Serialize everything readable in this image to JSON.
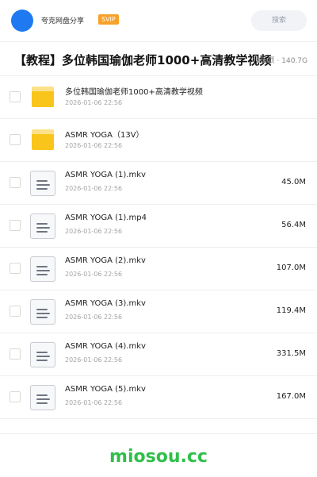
{
  "header": {
    "app_name": "夸克网盘分享",
    "badge": "SVIP",
    "search_placeholder": "搜索"
  },
  "title_bar": {
    "title": "【教程】多位韩国瑜伽老师1000+高清教学视频",
    "meta": "93 项 · 140.7G"
  },
  "files": [
    {
      "name": "多位韩国瑜伽老师1000+高清教学视频",
      "date": "2026-01-06 22:56",
      "size": "",
      "type": "folder",
      "icon": "folder-icon"
    },
    {
      "name": "ASMR YOGA（13V）",
      "date": "2026-01-06 22:56",
      "size": "",
      "type": "folder",
      "icon": "folder-icon"
    },
    {
      "name": "ASMR YOGA (1).mkv",
      "date": "2026-01-06 22:56",
      "size": "45.0M",
      "type": "file",
      "icon": "file-icon"
    },
    {
      "name": "ASMR YOGA (1).mp4",
      "date": "2026-01-06 22:56",
      "size": "56.4M",
      "type": "file",
      "icon": "file-icon"
    },
    {
      "name": "ASMR YOGA (2).mkv",
      "date": "2026-01-06 22:56",
      "size": "107.0M",
      "type": "file",
      "icon": "file-icon"
    },
    {
      "name": "ASMR YOGA (3).mkv",
      "date": "2026-01-06 22:56",
      "size": "119.4M",
      "type": "file",
      "icon": "file-icon"
    },
    {
      "name": "ASMR YOGA (4).mkv",
      "date": "2026-01-06 22:56",
      "size": "331.5M",
      "type": "file",
      "icon": "file-icon"
    },
    {
      "name": "ASMR YOGA (5).mkv",
      "date": "2026-01-06 22:56",
      "size": "167.0M",
      "type": "file",
      "icon": "file-icon"
    }
  ],
  "footer": {
    "watermark": "miosou.cc"
  },
  "colors": {
    "accent": "#1f7af2",
    "svip": "#f6a12a",
    "folder": "#f9c51b",
    "watermark": "#2fbf4a"
  }
}
